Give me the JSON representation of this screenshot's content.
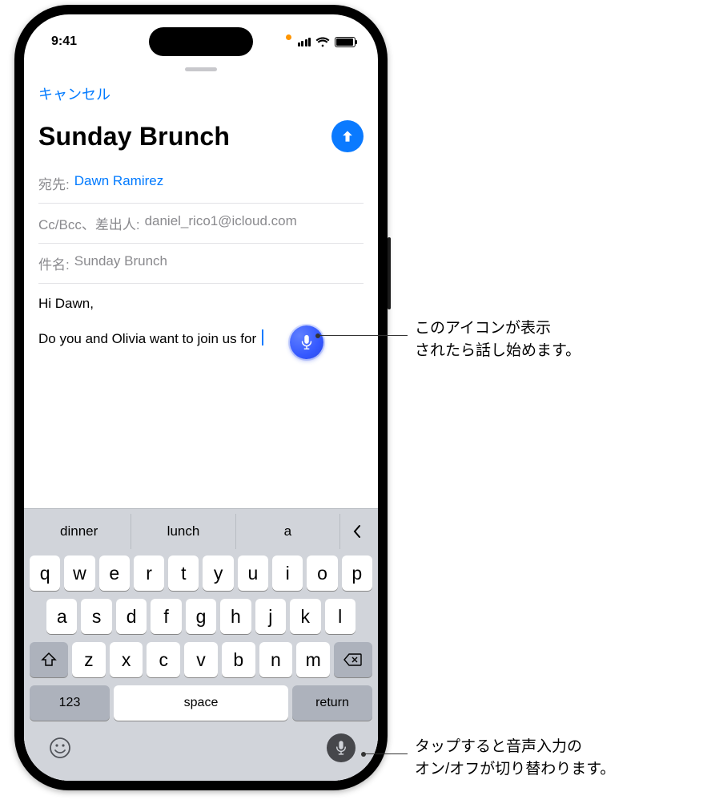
{
  "status": {
    "time": "9:41"
  },
  "nav": {
    "cancel": "キャンセル"
  },
  "compose": {
    "title": "Sunday Brunch",
    "to_label": "宛先:",
    "to_value": "Dawn Ramirez",
    "ccbcc_label": "Cc/Bcc、差出人:",
    "ccbcc_value": "daniel_rico1@icloud.com",
    "subject_label": "件名:",
    "subject_value": "Sunday Brunch",
    "body_line1": "Hi Dawn,",
    "body_line2": "Do you and Olivia want to join us for "
  },
  "keyboard": {
    "suggestions": [
      "dinner",
      "lunch",
      "a"
    ],
    "row1": [
      "q",
      "w",
      "e",
      "r",
      "t",
      "y",
      "u",
      "i",
      "o",
      "p"
    ],
    "row2": [
      "a",
      "s",
      "d",
      "f",
      "g",
      "h",
      "j",
      "k",
      "l"
    ],
    "row3": [
      "z",
      "x",
      "c",
      "v",
      "b",
      "n",
      "m"
    ],
    "numbers_key": "123",
    "space_key": "space",
    "return_key": "return"
  },
  "callouts": {
    "dictation_bubble": "このアイコンが表示\nされたら話し始めます。",
    "mic_toggle": "タップすると音声入力の\nオン/オフが切り替わります。"
  },
  "icons": {
    "send": "arrow-up",
    "mic": "microphone"
  }
}
